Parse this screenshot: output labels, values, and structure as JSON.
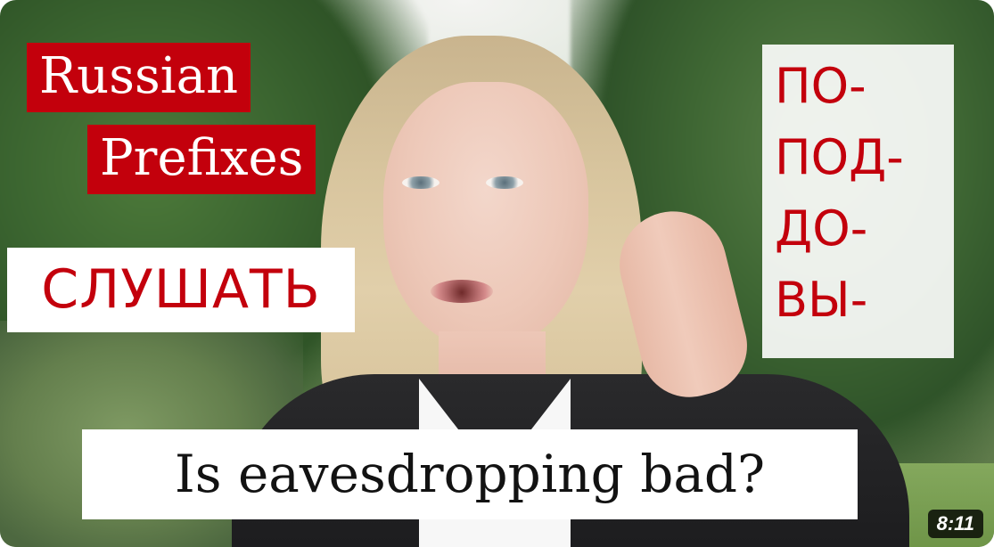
{
  "thumbnail": {
    "title_lines": [
      "Russian",
      "Prefixes"
    ],
    "verb": "СЛУШАТЬ",
    "prefixes": [
      "ПО-",
      "ПОД-",
      "ДО-",
      "ВЫ-"
    ],
    "question": "Is eavesdropping bad?",
    "duration": "8:11"
  },
  "colors": {
    "accent_red": "#c3000c",
    "box_white": "#ffffff",
    "text_dark": "#121212",
    "badge_bg": "#000000"
  }
}
